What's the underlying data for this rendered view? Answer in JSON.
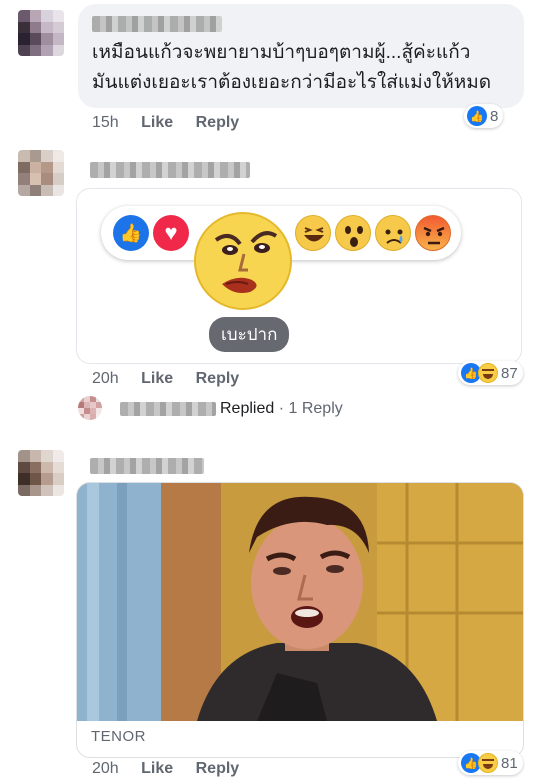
{
  "comments": [
    {
      "text_line1": "เหมือนแก้วจะพยายามบ้าๆบอๆตามผู้...สู้ค่ะแก้ว",
      "text_line2": "มันแต่งเยอะเราต้องเยอะกว่ามีอะไรใส่แม่งให้หมด",
      "time": "15h",
      "like_label": "Like",
      "reply_label": "Reply",
      "reaction_count": "8"
    },
    {
      "sticker_tooltip": "เบะปาก",
      "time": "20h",
      "like_label": "Like",
      "reply_label": "Reply",
      "reaction_count": "87",
      "replies_label": "Replied",
      "replies_count": "· 1 Reply"
    },
    {
      "gif_source": "TENOR",
      "time": "20h",
      "like_label": "Like",
      "reply_label": "Reply",
      "reaction_count": "81"
    }
  ],
  "colors": {
    "accent_blue": "#1877f2",
    "love_red": "#f02849",
    "haha_yellow": "#f7cd46",
    "meta_gray": "#606770",
    "bubble_gray": "#f0f2f5"
  },
  "icons": [
    "like-icon",
    "haha-icon",
    "love-icon",
    "wow-icon",
    "sad-icon",
    "angry-icon"
  ]
}
